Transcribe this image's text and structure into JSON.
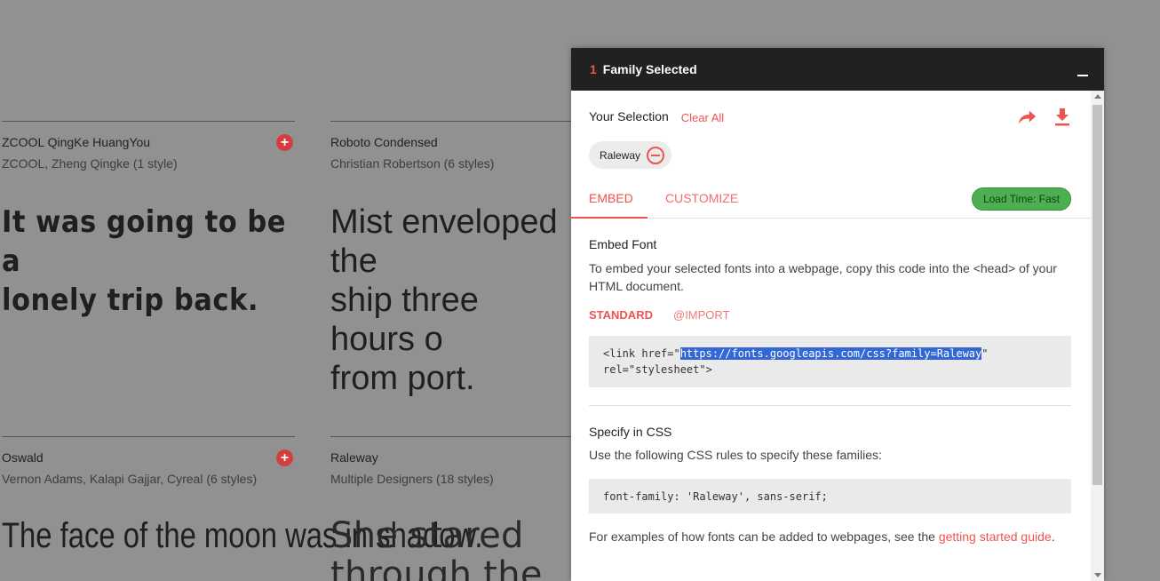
{
  "cards": [
    {
      "id": "zcool",
      "name": "ZCOOL QingKe HuangYou",
      "meta": "ZCOOL, Zheng Qingke (1 style)",
      "sample": "It was going to be a\nlonely trip back.",
      "has_add": true
    },
    {
      "id": "roboto",
      "name": "Roboto Condensed",
      "meta": "Christian Robertson (6 styles)",
      "sample": "Mist enveloped the\nship three hours o\nfrom port.",
      "has_add": false
    },
    {
      "id": "oswald",
      "name": "Oswald",
      "meta": "Vernon Adams, Kalapi Gajjar, Cyreal (6 styles)",
      "sample": "The face of the moon\nwas in shadow.",
      "has_add": true
    },
    {
      "id": "raleway",
      "name": "Raleway",
      "meta": "Multiple Designers (18 styles)",
      "sample": "She stared\nthrough the",
      "has_add": false
    }
  ],
  "drawer": {
    "count": "1",
    "title": "Family Selected",
    "selection_label": "Your Selection",
    "clear_all": "Clear All",
    "chip_label": "Raleway",
    "tabs": {
      "embed": "EMBED",
      "customize": "CUSTOMIZE"
    },
    "load_time": "Load Time: Fast",
    "embed_title": "Embed Font",
    "embed_text": "To embed your selected fonts into a webpage, copy this code into the <head> of your HTML document.",
    "sub_tabs": {
      "standard": "STANDARD",
      "import": "@IMPORT"
    },
    "code_prefix": "<link href=\"",
    "code_url": "https://fonts.googleapis.com/css?family=Raleway",
    "code_suffix": "\" rel=\"stylesheet\">",
    "css_title": "Specify in CSS",
    "css_text": "Use the following CSS rules to specify these families:",
    "css_code": "font-family: 'Raleway', sans-serif;",
    "footer_text": "For examples of how fonts can be added to webpages, see the ",
    "footer_link": "getting started guide",
    "footer_end": "."
  },
  "colors": {
    "accent": "#ef5350",
    "header_bg": "#212121",
    "load_badge": "#4caf50",
    "page_bg": "#919191"
  },
  "icons": [
    "add-icon",
    "share-icon",
    "download-icon",
    "remove-circle-icon",
    "minimize-icon"
  ]
}
